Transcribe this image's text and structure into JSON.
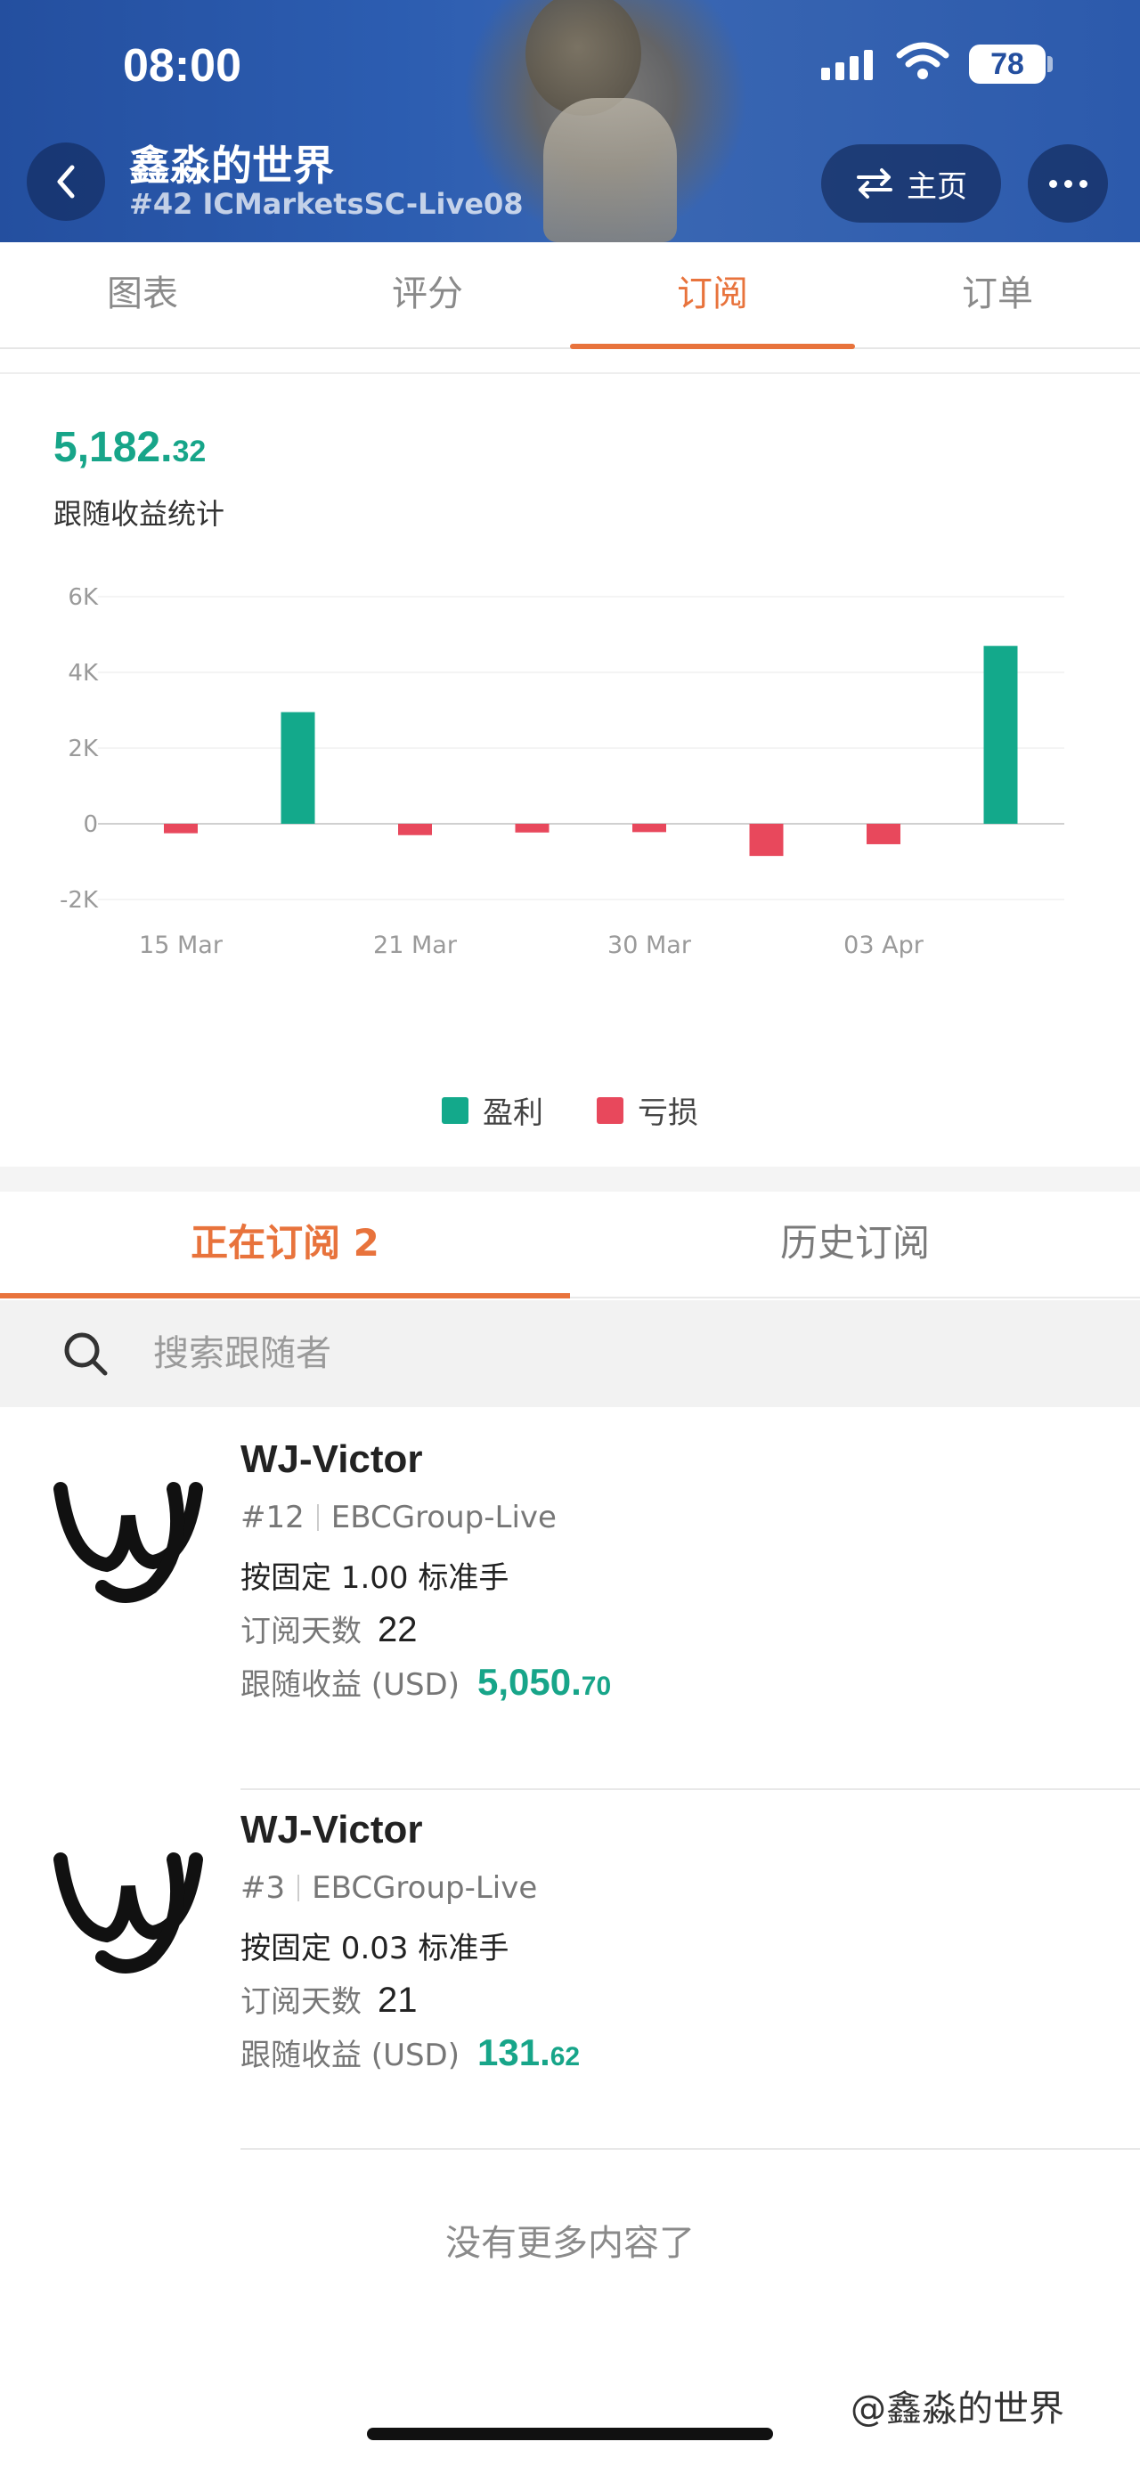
{
  "status_bar": {
    "time": "08:00",
    "battery": "78"
  },
  "header": {
    "title": "鑫淼的世界",
    "subtitle": "#42 ICMarketsSC-Live08",
    "home_label": "主页"
  },
  "tabs": [
    {
      "label": "图表"
    },
    {
      "label": "评分"
    },
    {
      "label": "订阅"
    },
    {
      "label": "订单"
    }
  ],
  "summary": {
    "total_main": "5,182.",
    "total_decimal": "32",
    "label": "跟随收益统计"
  },
  "chart_data": {
    "type": "bar",
    "title": "",
    "yticks": [
      "6K",
      "4K",
      "2K",
      "0",
      "-2K"
    ],
    "ylim": [
      -2000,
      6000
    ],
    "xtick_labels": [
      "15 Mar",
      "21 Mar",
      "30 Mar",
      "03 Apr"
    ],
    "bars": [
      {
        "series": "亏损",
        "value": -250
      },
      {
        "series": "盈利",
        "value": 2950
      },
      {
        "series": "亏损",
        "value": -300
      },
      {
        "series": "亏损",
        "value": -230
      },
      {
        "series": "亏损",
        "value": -220
      },
      {
        "series": "亏损",
        "value": -850
      },
      {
        "series": "亏损",
        "value": -540
      },
      {
        "series": "盈利",
        "value": 4700
      }
    ],
    "legend": [
      {
        "name": "盈利",
        "color": "#13a98b"
      },
      {
        "name": "亏损",
        "color": "#e8485c"
      }
    ],
    "legend_position": "bottom",
    "grid": true
  },
  "sub_tabs": [
    {
      "label": "正在订阅 2"
    },
    {
      "label": "历史订阅"
    }
  ],
  "search": {
    "placeholder": "搜索跟随者"
  },
  "subscriptions": [
    {
      "name": "WJ-Victor",
      "account_no": "#12",
      "server": "EBCGroup-Live",
      "mode": "按固定 1.00 标准手",
      "days_label": "订阅天数",
      "days": "22",
      "profit_label": "跟随收益 (USD)",
      "profit_main": "5,050.",
      "profit_decimal": "70"
    },
    {
      "name": "WJ-Victor",
      "account_no": "#3",
      "server": "EBCGroup-Live",
      "mode": "按固定 0.03 标准手",
      "days_label": "订阅天数",
      "days": "21",
      "profit_label": "跟随收益 (USD)",
      "profit_main": "131.",
      "profit_decimal": "62"
    }
  ],
  "footer": {
    "no_more": "没有更多内容了",
    "watermark": "@鑫淼的世界"
  },
  "colors": {
    "accent": "#e8733c",
    "profit": "#17a589",
    "loss": "#e8485c",
    "header": "#2c5aac"
  }
}
